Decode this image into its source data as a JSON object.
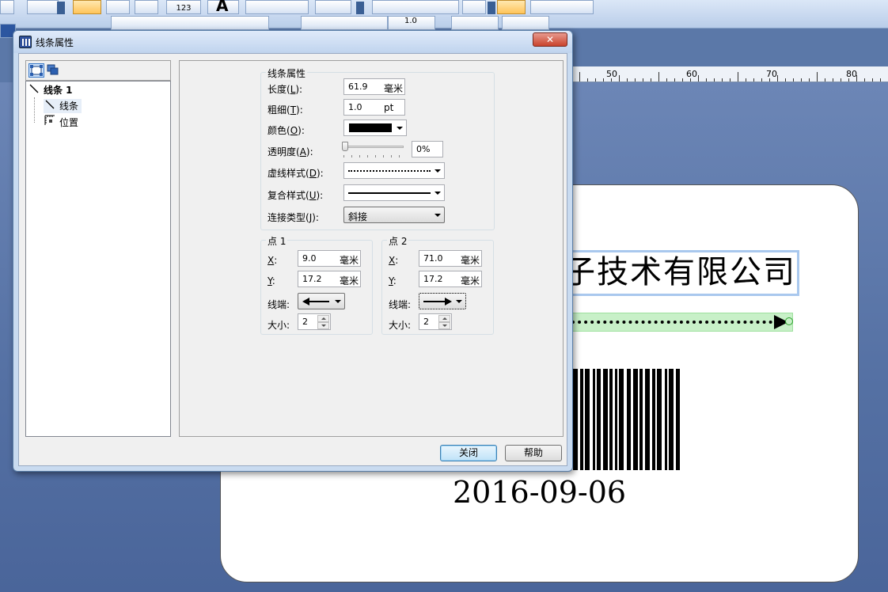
{
  "toolbar": {
    "barcode_tool_caption": "123",
    "text_tool_glyph": "A",
    "font_size_value": "1.0"
  },
  "ruler": {
    "marks": [
      "50",
      "60",
      "70",
      "80"
    ]
  },
  "label_canvas": {
    "company_text": "子技术有限公司",
    "date_text": "2016-09-06"
  },
  "dialog": {
    "title": "线条属性",
    "close_glyph": "✕",
    "tree": {
      "root": "线条 1",
      "items": [
        "线条",
        "位置"
      ]
    },
    "line_props": {
      "group_title": "线条属性",
      "length_label": "长度(L):",
      "length_key": "L",
      "length_value": "61.9",
      "length_unit": "毫米",
      "width_label": "粗细(T):",
      "width_value": "1.0",
      "width_unit": "pt",
      "color_label": "颜色(O):",
      "color_value": "#000000",
      "transparency_label": "透明度(A):",
      "transparency_value": "0%",
      "transparency_level": 0,
      "dash_label": "虚线样式(D):",
      "compound_label": "复合样式(U):",
      "join_label": "连接类型(J):",
      "join_value": "斜接"
    },
    "point1": {
      "title": "点 1",
      "x_label": "X:",
      "x_value": "9.0",
      "x_unit": "毫米",
      "y_label": "Y:",
      "y_value": "17.2",
      "y_unit": "毫米",
      "end_label": "线端:",
      "end_icon": "arrow-left-icon",
      "size_label": "大小:",
      "size_value": "2"
    },
    "point2": {
      "title": "点 2",
      "x_label": "X:",
      "x_value": "71.0",
      "x_unit": "毫米",
      "y_label": "Y:",
      "y_value": "17.2",
      "y_unit": "毫米",
      "end_label": "线端:",
      "end_icon": "arrow-right-icon",
      "size_label": "大小:",
      "size_value": "2"
    },
    "buttons": {
      "close": "关闭",
      "help": "帮助"
    }
  }
}
